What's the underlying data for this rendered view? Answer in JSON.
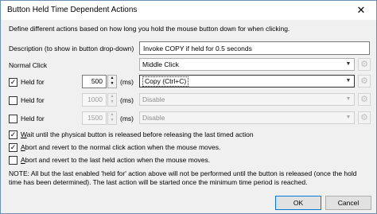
{
  "window": {
    "title": "Button Held Time Dependent Actions",
    "close_glyph": "✕"
  },
  "intro": "Define different actions based on how long you hold the mouse button down for when clicking.",
  "description": {
    "label": "Description (to show in button drop-down)",
    "value": "Invoke COPY if held for 0.5 seconds"
  },
  "normal_click": {
    "label": "Normal Click",
    "action": "Middle Click"
  },
  "held_rows": [
    {
      "label": "Held for",
      "checked": true,
      "value": "500",
      "unit": "(ms)",
      "action": "Copy (Ctrl+C)",
      "enabled": true
    },
    {
      "label": "Held for",
      "checked": false,
      "value": "1000",
      "unit": "(ms)",
      "action": "Disable",
      "enabled": false
    },
    {
      "label": "Held for",
      "checked": false,
      "value": "1500",
      "unit": "(ms)",
      "action": "Disable",
      "enabled": false
    }
  ],
  "options": [
    {
      "mnemonic": "W",
      "rest": "ait until the physical button is released before releasing the last timed action",
      "checked": true
    },
    {
      "mnemonic": "A",
      "rest": "bort and revert to the normal click action when the mouse moves.",
      "checked": true
    },
    {
      "mnemonic": "A",
      "rest": "bort and revert to the last held action when the mouse moves.",
      "checked": false
    }
  ],
  "note": "NOTE: All but the last enabled 'held for' action above will not be performed until the button is released (once the hold time has been determined). The last action will be started once the minimum time period is reached.",
  "buttons": {
    "ok": "OK",
    "cancel": "Cancel"
  },
  "icons": {
    "gear": "gear-icon",
    "dropdown": "chevron-down-icon",
    "check": "checkmark-icon"
  }
}
